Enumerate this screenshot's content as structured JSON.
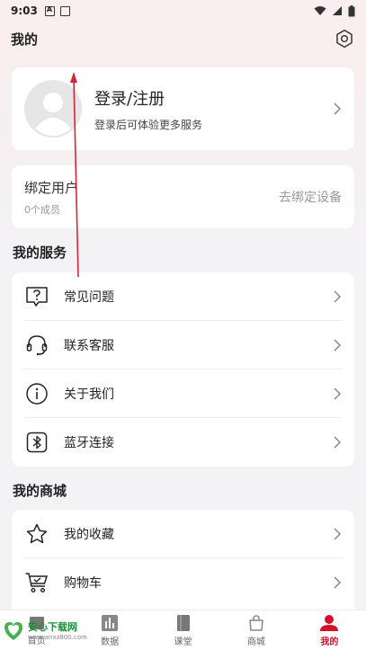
{
  "status_bar": {
    "time": "9:03"
  },
  "header": {
    "title": "我的"
  },
  "profile": {
    "title": "登录/注册",
    "subtitle": "登录后可体验更多服务"
  },
  "bind": {
    "title": "绑定用户",
    "subtitle": "0个成员",
    "action": "去绑定设备"
  },
  "services": {
    "title": "我的服务",
    "items": [
      {
        "label": "常见问题",
        "icon": "question-icon"
      },
      {
        "label": "联系客服",
        "icon": "headset-icon"
      },
      {
        "label": "关于我们",
        "icon": "info-icon"
      },
      {
        "label": "蓝牙连接",
        "icon": "bluetooth-icon"
      }
    ]
  },
  "mall": {
    "title": "我的商城",
    "items": [
      {
        "label": "我的收藏",
        "icon": "star-icon"
      },
      {
        "label": "购物车",
        "icon": "cart-icon"
      }
    ]
  },
  "tabs": [
    {
      "label": "首页"
    },
    {
      "label": "数据"
    },
    {
      "label": "课堂"
    },
    {
      "label": "商城"
    },
    {
      "label": "我的"
    }
  ],
  "watermark": {
    "main": "安心下载网",
    "sub": "www.anxz800.com"
  },
  "colors": {
    "accent": "#d4112a",
    "annotation": "#d0283a"
  }
}
